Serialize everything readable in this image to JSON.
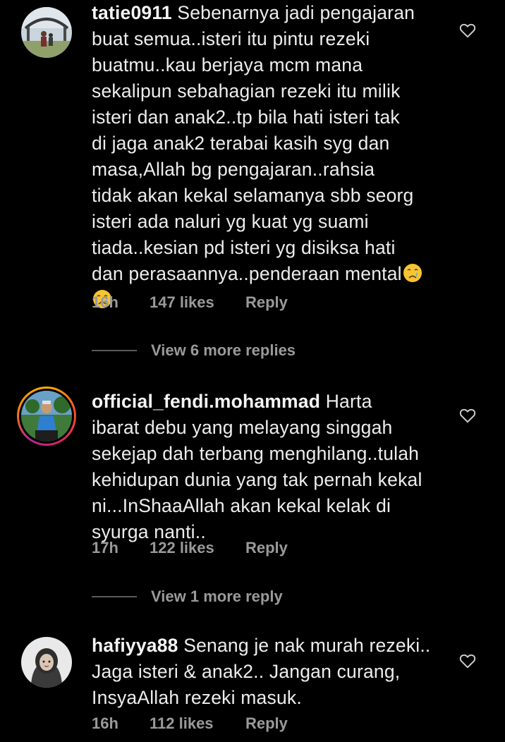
{
  "comments": [
    {
      "username": "tatie0911",
      "lines": [
        "Sebenarnya jadi pengajaran",
        "buat semua..isteri itu pintu rezeki",
        "buatmu..kau berjaya mcm mana",
        "sekalipun sebahagian rezeki itu milik",
        "isteri dan anak2..tp bila hati isteri tak",
        "di jaga anak2 terabai kasih syg dan",
        "masa,Allah bg pengajaran..rahsia",
        "tidak akan kekal selamanya sbb seorg",
        "isteri ada naluri yg kuat yg suami",
        "tiada..kesian pd isteri yg disiksa hati",
        "dan perasaannya..penderaan mental"
      ],
      "emoji": "crying-face",
      "time": "16h",
      "likes": "147 likes",
      "reply": "Reply",
      "view_more": "View 6 more replies"
    },
    {
      "username": "official_fendi.mohammad",
      "lines": [
        "Harta",
        "ibarat debu yang melayang singgah",
        "sekejap dah terbang menghilang..tulah",
        "kehidupan dunia yang tak pernah kekal",
        "ni...InShaaAllah akan kekal kelak di",
        "syurga nanti.."
      ],
      "time": "17h",
      "likes": "122 likes",
      "reply": "Reply",
      "view_more": "View 1 more reply"
    },
    {
      "username": "hafiyya88",
      "lines": [
        "Senang je nak murah rezeki..",
        "Jaga isteri & anak2.. Jangan curang,",
        "InsyaAllah rezeki masuk."
      ],
      "time": "16h",
      "likes": "112 likes",
      "reply": "Reply"
    }
  ],
  "icons": {
    "like": "heart-outline-icon",
    "emoji": "crying-face-emoji"
  },
  "colors": {
    "background": "#000000",
    "text": "#ededed",
    "meta": "#9a9a9a",
    "story_ring": "#e0245e"
  }
}
